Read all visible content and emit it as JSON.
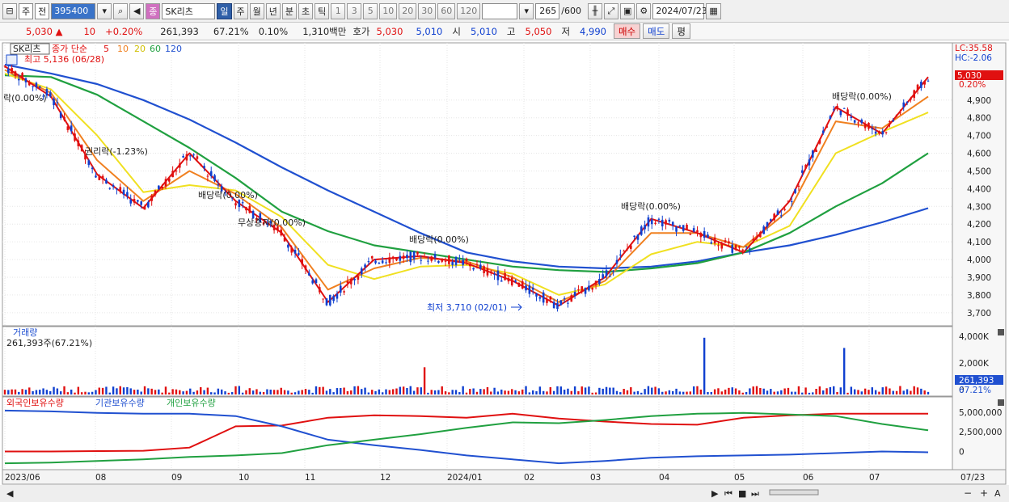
{
  "toolbar": {
    "period_type": "주",
    "prev_label": "전",
    "code": "395400",
    "name_badge": "종",
    "name": "SK리츠",
    "periods": [
      "일",
      "주",
      "월",
      "년",
      "분",
      "초",
      "틱"
    ],
    "active_period": "일",
    "nums": [
      "1",
      "3",
      "5",
      "10",
      "20",
      "30",
      "60",
      "120"
    ],
    "count": "265",
    "total": "/600",
    "date": "2024/07/23"
  },
  "quote": {
    "price": "5,030",
    "arrow": "▲",
    "change": "10",
    "change_pct": "+0.20%",
    "volume": "261,393",
    "vol_ratio": "67.21%",
    "turnover_pct": "0.10%",
    "amount": "1,310백만",
    "ask_label": "호가",
    "ask1": "5,030",
    "ask2": "5,010",
    "open_label": "시",
    "open": "5,010",
    "high_label": "고",
    "high": "5,050",
    "low_label": "저",
    "low": "4,990",
    "buy": "매수",
    "sell": "매도",
    "eval": "평"
  },
  "legend": {
    "name": "SK리츠",
    "ma_label": "종가 단순",
    "ma": [
      {
        "p": "5",
        "color": "#e01010"
      },
      {
        "p": "10",
        "color": "#f08020"
      },
      {
        "p": "20",
        "color": "#f0e020"
      },
      {
        "p": "60",
        "color": "#20a040"
      },
      {
        "p": "120",
        "color": "#2050d0"
      }
    ],
    "max": "최고 5,136 (06/28)",
    "min": "최저 3,710 (02/01)",
    "lc": "LC:35.58",
    "hc": "HC:-2.06",
    "current": "5,030",
    "current_pct": "0.20%"
  },
  "annotations": [
    {
      "text": "락(0.00%)"
    },
    {
      "text": "권리락(-1.23%)"
    },
    {
      "text": "배당락(0.00%)"
    },
    {
      "text": "무상증자(0.00%)"
    },
    {
      "text": "배당락(0.00%)"
    },
    {
      "text": "배당락(0.00%)"
    },
    {
      "text": "배당락(0.00%)"
    }
  ],
  "volume_panel": {
    "title": "거래량",
    "info": "261,393주(67.21%)",
    "ticks": [
      "4,000K",
      "2,000K",
      "0"
    ],
    "current": "261,393",
    "current_pct": "67.21%"
  },
  "holdings_panel": {
    "labels": [
      "외국인보유수량",
      "기관보유수량",
      "개인보유수량"
    ],
    "colors": [
      "#e01010",
      "#2050d0",
      "#20a040"
    ],
    "ticks": [
      "5,000,000",
      "2,500,000",
      "0"
    ]
  },
  "chart_data": {
    "type": "line",
    "price_y_ticks": [
      "4,900",
      "4,800",
      "4,700",
      "4,600",
      "4,500",
      "4,400",
      "4,300",
      "4,200",
      "4,100",
      "4,000",
      "3,900",
      "3,800",
      "3,700"
    ],
    "x_ticks": [
      "2023/06",
      "08",
      "09",
      "10",
      "11",
      "12",
      "2024/01",
      "02",
      "03",
      "04",
      "05",
      "06",
      "07"
    ],
    "right_date": "07/23",
    "ylim": [
      3640,
      5200
    ],
    "series": [
      {
        "name": "5",
        "t": [
          0,
          5,
          10,
          15,
          20,
          25,
          30,
          35,
          40,
          45,
          50,
          55,
          60,
          65,
          70,
          75,
          80,
          85,
          90,
          95,
          100
        ],
        "values": [
          5090,
          4920,
          4480,
          4290,
          4600,
          4330,
          4150,
          3760,
          4000,
          4020,
          3980,
          3880,
          3740,
          3900,
          4230,
          4150,
          4040,
          4330,
          4860,
          4710,
          5030
        ]
      },
      {
        "name": "10",
        "t": [
          0,
          5,
          10,
          15,
          20,
          25,
          30,
          35,
          40,
          45,
          50,
          55,
          60,
          65,
          70,
          75,
          80,
          85,
          90,
          95,
          100
        ],
        "values": [
          5070,
          4940,
          4560,
          4330,
          4500,
          4370,
          4180,
          3830,
          3950,
          4010,
          3990,
          3900,
          3760,
          3880,
          4150,
          4150,
          4070,
          4280,
          4780,
          4740,
          4920
        ]
      },
      {
        "name": "20",
        "t": [
          0,
          5,
          10,
          15,
          20,
          25,
          30,
          35,
          40,
          45,
          50,
          55,
          60,
          65,
          70,
          75,
          80,
          85,
          90,
          95,
          100
        ],
        "values": [
          5050,
          4960,
          4700,
          4380,
          4420,
          4390,
          4240,
          3970,
          3890,
          3960,
          3970,
          3920,
          3800,
          3860,
          4030,
          4100,
          4070,
          4190,
          4600,
          4720,
          4830
        ]
      },
      {
        "name": "60",
        "t": [
          0,
          5,
          10,
          15,
          20,
          25,
          30,
          35,
          40,
          45,
          50,
          55,
          60,
          65,
          70,
          75,
          80,
          85,
          90,
          95,
          100
        ],
        "values": [
          5040,
          5030,
          4930,
          4780,
          4630,
          4460,
          4270,
          4160,
          4080,
          4040,
          4000,
          3960,
          3940,
          3930,
          3950,
          3980,
          4040,
          4150,
          4300,
          4430,
          4600
        ]
      },
      {
        "name": "120",
        "t": [
          0,
          5,
          10,
          15,
          20,
          25,
          30,
          35,
          40,
          45,
          50,
          55,
          60,
          65,
          70,
          75,
          80,
          85,
          90,
          95,
          100
        ],
        "values": [
          5100,
          5050,
          4990,
          4900,
          4790,
          4660,
          4520,
          4390,
          4270,
          4150,
          4040,
          3990,
          3960,
          3950,
          3960,
          3990,
          4040,
          4080,
          4140,
          4210,
          4290
        ]
      }
    ],
    "holdings": [
      {
        "name": "외국인보유수량",
        "values": [
          0,
          0,
          0.05,
          0.1,
          0.5,
          3.2,
          3.3,
          4.3,
          4.6,
          4.5,
          4.3,
          4.8,
          4.2,
          3.8,
          3.5,
          3.4,
          4.3,
          4.6,
          4.8,
          4.8,
          4.8
        ]
      },
      {
        "name": "기관보유수량",
        "values": [
          5.2,
          5.1,
          4.9,
          4.8,
          4.8,
          4.5,
          3.2,
          1.5,
          0.8,
          0.2,
          -0.5,
          -1.0,
          -1.5,
          -1.2,
          -0.8,
          -0.6,
          -0.5,
          -0.4,
          -0.2,
          0,
          -0.1
        ]
      },
      {
        "name": "개인보유수량",
        "values": [
          -1.5,
          -1.4,
          -1.2,
          -1.0,
          -0.7,
          -0.5,
          -0.2,
          0.8,
          1.5,
          2.2,
          3.0,
          3.7,
          3.6,
          4.0,
          4.5,
          4.8,
          4.9,
          4.7,
          4.5,
          3.5,
          2.7
        ]
      }
    ]
  }
}
